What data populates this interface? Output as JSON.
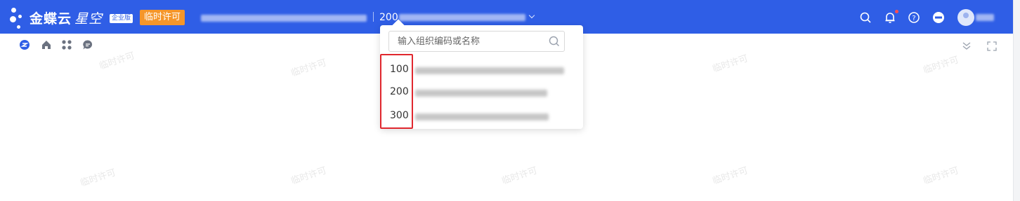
{
  "header": {
    "brand_main": "金蝶云",
    "brand_sub": "星空",
    "edition": "企业版",
    "license_badge": "临时许可",
    "current_org_code": "200",
    "icons": [
      "search-icon",
      "bell-icon",
      "help-icon",
      "minus-circle-icon",
      "avatar"
    ]
  },
  "subbar": {
    "icons": [
      "refresh-icon",
      "home-icon",
      "apps-icon",
      "chat-icon",
      "collapse-down-icon",
      "fullscreen-icon"
    ]
  },
  "watermark_text": "临时许可",
  "org_dropdown": {
    "search_placeholder": "输入组织编码或名称",
    "items": [
      {
        "code": "100"
      },
      {
        "code": "200"
      },
      {
        "code": "300"
      }
    ]
  },
  "colors": {
    "header_bg": "#2f5ee6",
    "license_bg": "#f5962a",
    "highlight_border": "#e0272e"
  }
}
